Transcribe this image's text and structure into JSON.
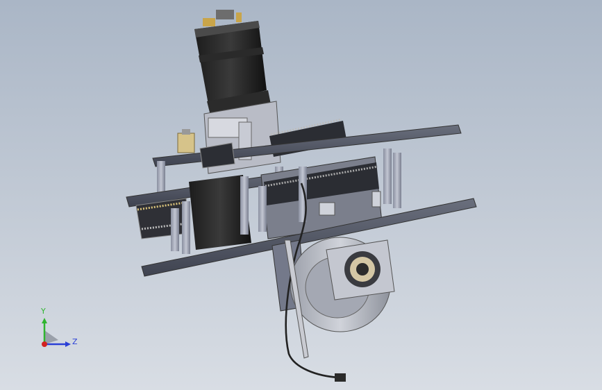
{
  "triad": {
    "y_label": "Y",
    "z_label": "Z",
    "y_color": "#2fb52f",
    "z_color": "#2a3fd6",
    "x_color": "#d22222"
  },
  "model_icon": "cad-assembly-wheel-module"
}
